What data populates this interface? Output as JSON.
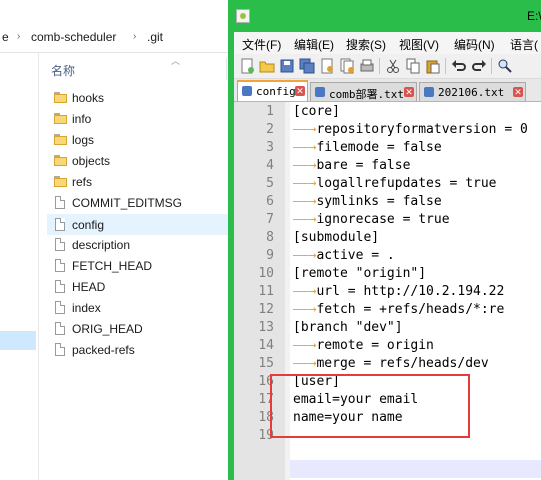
{
  "explorer": {
    "breadcrumb": {
      "part1": "e",
      "part2": "comb-scheduler",
      "part3": ".git"
    },
    "column_header": "名称",
    "files": [
      {
        "name": "hooks",
        "type": "folder"
      },
      {
        "name": "info",
        "type": "folder"
      },
      {
        "name": "logs",
        "type": "folder"
      },
      {
        "name": "objects",
        "type": "folder"
      },
      {
        "name": "refs",
        "type": "folder"
      },
      {
        "name": "COMMIT_EDITMSG",
        "type": "file"
      },
      {
        "name": "config",
        "type": "file",
        "selected": true
      },
      {
        "name": "description",
        "type": "file"
      },
      {
        "name": "FETCH_HEAD",
        "type": "file"
      },
      {
        "name": "HEAD",
        "type": "file"
      },
      {
        "name": "index",
        "type": "file"
      },
      {
        "name": "ORIG_HEAD",
        "type": "file"
      },
      {
        "name": "packed-refs",
        "type": "file"
      }
    ]
  },
  "notepad": {
    "title": "E:\\",
    "menu": [
      "文件(F)",
      "编辑(E)",
      "搜索(S)",
      "视图(V)",
      "编码(N)",
      "语言("
    ],
    "tabs": [
      {
        "label": "config",
        "active": true
      },
      {
        "label": "comb部署.txt"
      },
      {
        "label": "202106.txt"
      }
    ],
    "lines": [
      {
        "n": "1",
        "text": "[core]"
      },
      {
        "n": "2",
        "text": "repositoryformatversion = 0"
      },
      {
        "n": "3",
        "text": "filemode = false"
      },
      {
        "n": "4",
        "text": "bare = false"
      },
      {
        "n": "5",
        "text": "logallrefupdates = true"
      },
      {
        "n": "6",
        "text": "symlinks = false"
      },
      {
        "n": "7",
        "text": "ignorecase = true"
      },
      {
        "n": "8",
        "text": "[submodule]"
      },
      {
        "n": "9",
        "text": "active = ."
      },
      {
        "n": "10",
        "text": "[remote \"origin\"]"
      },
      {
        "n": "11",
        "text": "url = http://10.2.194.22"
      },
      {
        "n": "12",
        "text": "fetch = +refs/heads/*:re"
      },
      {
        "n": "13",
        "text": "[branch \"dev\"]"
      },
      {
        "n": "14",
        "text": "remote = origin"
      },
      {
        "n": "15",
        "text": "merge = refs/heads/dev"
      },
      {
        "n": "16",
        "text": "[user]"
      },
      {
        "n": "17",
        "text": "email=your email"
      },
      {
        "n": "18",
        "text": "name=your name"
      },
      {
        "n": "19",
        "text": ""
      }
    ]
  },
  "colors": {
    "npp_chrome": "#2bbd4a",
    "highlight_box": "#e53b3b",
    "whitespace_marker": "#f0a030"
  }
}
